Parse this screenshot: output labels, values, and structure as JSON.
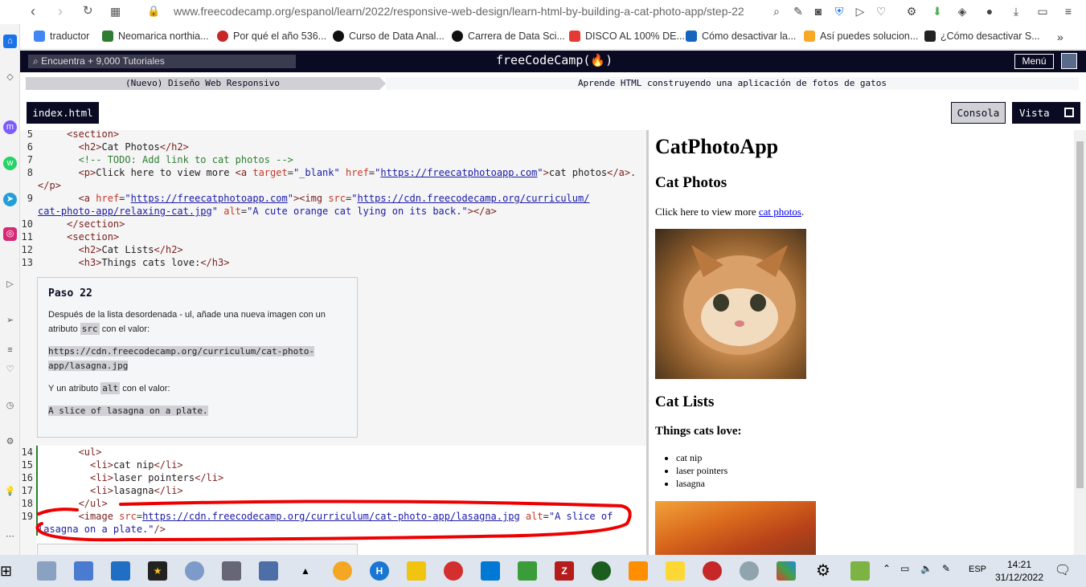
{
  "browser": {
    "url": "www.freecodecamp.org/espanol/learn/2022/responsive-web-design/learn-html-by-building-a-cat-photo-app/step-22",
    "bookmarks": [
      "traductor",
      "Neomarica northia...",
      "Por qué el año 536...",
      "Curso de Data Anal...",
      "Carrera de Data Sci...",
      "DISCO AL 100% DE...",
      "Cómo desactivar la...",
      "Así puedes solucion...",
      "¿Cómo desactivar S..."
    ]
  },
  "fcc": {
    "search_placeholder": "Encuentra + 9,000 Tutoriales",
    "brand": "freeCodeCamp(🔥)",
    "menu_label": "Menú",
    "breadcrumb_course": "(Nuevo) Diseño Web Responsivo",
    "breadcrumb_project": "Aprende HTML construyendo una aplicación de fotos de gatos",
    "file_tab": "index.html",
    "console_label": "Consola",
    "preview_label": "Vista"
  },
  "editor": {
    "line_numbers_top": [
      "5",
      "6",
      "7",
      "8",
      "",
      "9",
      "",
      "10",
      "11",
      "12",
      "13"
    ],
    "line_numbers_bottom": [
      "14",
      "15",
      "16",
      "17",
      "18",
      "19",
      ""
    ]
  },
  "step": {
    "title": "Paso 22",
    "text1": "Después de la lista desordenada - ul, añade una nueva imagen con un atributo",
    "code_src": "src",
    "text1b": "con el valor:",
    "url_line1": "https://cdn.freecodecamp.org/curriculum/cat-photo-",
    "url_line2": "app/lasagna.jpg",
    "text2": "Y un atributo",
    "code_alt": "alt",
    "text2b": "con el valor:",
    "alt_value": "A slice of lasagna on a plate."
  },
  "preview": {
    "h1": "CatPhotoApp",
    "h2": "Cat Photos",
    "p_text": "Click here to view more",
    "p_link": "cat photos",
    "p_end": ".",
    "h2b": "Cat Lists",
    "h3": "Things cats love:",
    "items": [
      "cat nip",
      "laser pointers",
      "lasagna"
    ]
  },
  "taskbar": {
    "time": "14:21",
    "date": "31/12/2022",
    "lang": "ESP"
  }
}
